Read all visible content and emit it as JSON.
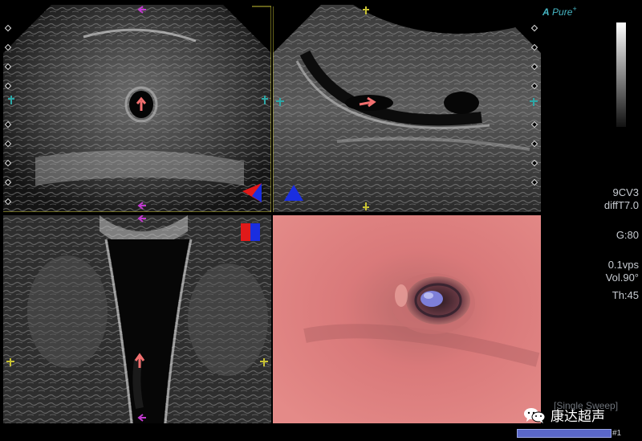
{
  "header": {
    "logo_glyph": "A",
    "logo_text": "Pure",
    "logo_sup": "+"
  },
  "settings": {
    "probe": "9CV3",
    "mode": "diffT7.0",
    "gain": "G:80",
    "speed": "0.1vps",
    "volume": "Vol.90°",
    "thickness": "Th:45"
  },
  "sweep": {
    "label": "[Single Sweep]",
    "progress_fraction": 1.0,
    "index": "#1"
  },
  "watermark": {
    "text": "康达超声"
  },
  "colors": {
    "accent_cyan": "#46b6c4",
    "render_pink": "#d9797a",
    "lumen_blue": "#7e7fd8",
    "arrow_salmon": "#f06f6f",
    "marker_magenta": "#c23ad0",
    "marker_yellow": "#c8c233",
    "marker_teal": "#2ea7a6",
    "orientation_red": "#e01a1a",
    "orientation_blue": "#1a2ee0"
  },
  "icons": {
    "wechat": "wechat-icon",
    "orientation_cube": "orientation-cube-icon",
    "direction_arrow": "direction-arrow-icon",
    "marker_arrow": "marker-arrow-icon"
  }
}
